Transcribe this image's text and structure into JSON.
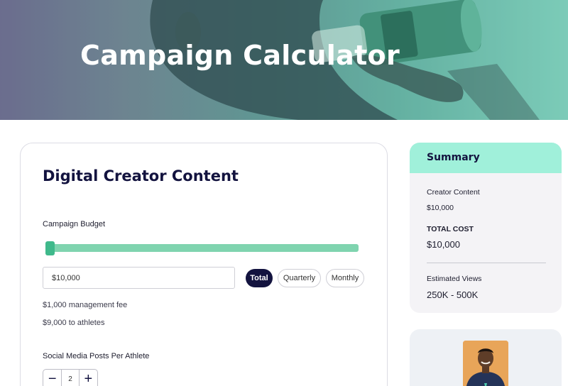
{
  "hero": {
    "title": "Campaign Calculator"
  },
  "calculator": {
    "title": "Digital Creator Content",
    "budget_label": "Campaign Budget",
    "budget_slider_fraction": 0.0,
    "budget_value": "$10,000",
    "frequency_options": [
      "Total",
      "Quarterly",
      "Monthly"
    ],
    "frequency_selected": "Total",
    "management_fee": "$1,000 management fee",
    "to_athletes": "$9,000 to athletes",
    "posts_label": "Social Media Posts Per Athlete",
    "posts_value": "2",
    "decrement_symbol": "−",
    "increment_symbol": "+"
  },
  "summary": {
    "title": "Summary",
    "creator_content_label": "Creator Content",
    "creator_content_value": "$10,000",
    "total_cost_label": "TOTAL COST",
    "total_cost_value": "$10,000",
    "views_label": "Estimated Views",
    "views_value": "250K - 500K"
  },
  "colors": {
    "navy": "#13133f",
    "mint": "#a0f0da",
    "slider": "#7fd4af",
    "slider_handle": "#3fb98b"
  }
}
